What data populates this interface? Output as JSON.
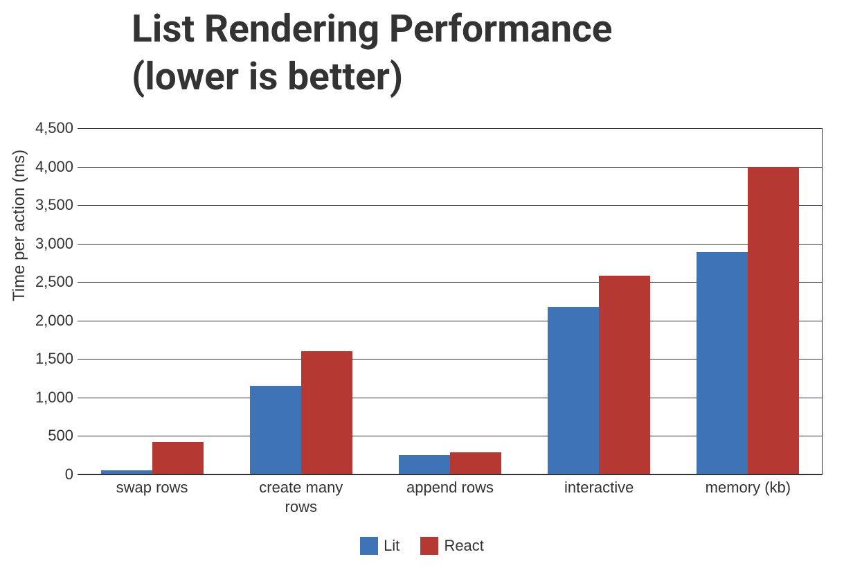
{
  "chart_data": {
    "type": "bar",
    "title": "List Rendering Performance (lower is better)",
    "title_line1": "List Rendering Performance",
    "title_line2": "(lower is better)",
    "xlabel": "",
    "ylabel": "Time per action (ms)",
    "ylim": [
      0,
      4500
    ],
    "y_ticks": [
      0,
      500,
      1000,
      1500,
      2000,
      2500,
      3000,
      3500,
      4000,
      4500
    ],
    "y_tick_labels": [
      "0",
      "500",
      "1,000",
      "1,500",
      "2,000",
      "2,500",
      "3,000",
      "3,500",
      "4,000",
      "4,500"
    ],
    "categories": [
      "swap rows",
      "create many rows",
      "append rows",
      "interactive",
      "memory (kb)"
    ],
    "category_labels": [
      "swap rows",
      "create many\nrows",
      "append rows",
      "interactive",
      "memory (kb)"
    ],
    "series": [
      {
        "name": "Lit",
        "color": "#3e74b5",
        "values": [
          50,
          1150,
          250,
          2180,
          2890
        ]
      },
      {
        "name": "React",
        "color": "#b63832",
        "values": [
          420,
          1600,
          290,
          2580,
          4000
        ]
      }
    ],
    "legend_position": "bottom",
    "grid": true
  }
}
